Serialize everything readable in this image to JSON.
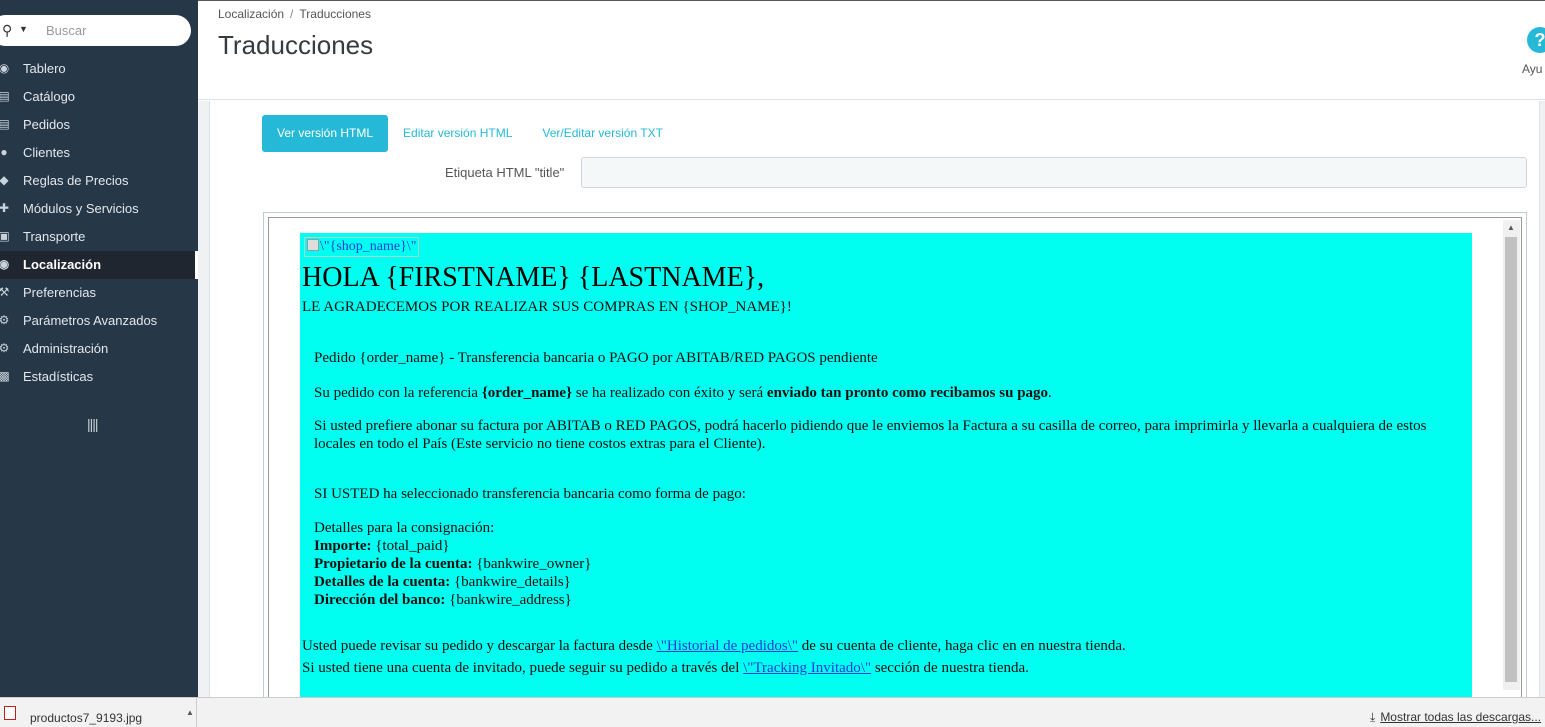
{
  "search": {
    "placeholder": "Buscar"
  },
  "sidebar": {
    "items": [
      {
        "label": "Tablero",
        "icon": "dashboard-icon"
      },
      {
        "label": "Catálogo",
        "icon": "catalog-icon"
      },
      {
        "label": "Pedidos",
        "icon": "orders-icon"
      },
      {
        "label": "Clientes",
        "icon": "customers-icon"
      },
      {
        "label": "Reglas de Precios",
        "icon": "price-rules-icon"
      },
      {
        "label": "Módulos y Servicios",
        "icon": "modules-icon"
      },
      {
        "label": "Transporte",
        "icon": "truck-icon"
      },
      {
        "label": "Localización",
        "icon": "globe-icon",
        "active": true
      },
      {
        "label": "Preferencias",
        "icon": "wrench-icon"
      },
      {
        "label": "Parámetros Avanzados",
        "icon": "cogs-icon"
      },
      {
        "label": "Administración",
        "icon": "cog-icon"
      },
      {
        "label": "Estadísticas",
        "icon": "bar-chart-icon"
      }
    ]
  },
  "header": {
    "breadcrumb": [
      "Localización",
      "Traducciones"
    ],
    "title": "Traducciones",
    "help_label": "Ayu"
  },
  "tabs": [
    {
      "label": "Ver versión HTML",
      "active": true
    },
    {
      "label": "Editar versión HTML",
      "active": false
    },
    {
      "label": "Ver/Editar versión TXT",
      "active": false
    }
  ],
  "title_field": {
    "label": "Etiqueta HTML \"title\"",
    "value": ""
  },
  "email": {
    "logo_alt": "\\\"{shop_name}\\\"",
    "greeting": "HOLA {FIRSTNAME} {LASTNAME},",
    "thanks": "LE AGRADECEMOS POR REALIZAR SUS COMPRAS EN {SHOP_NAME}!",
    "order_line": "Pedido {order_name} - Transferencia bancaria o PAGO por ABITAB/RED PAGOS pendiente",
    "ref_pre": "Su pedido con la referencia ",
    "ref_bold": "{order_name}",
    "ref_mid": " se ha realizado con éxito y será ",
    "ref_bold2": "enviado tan pronto como recibamos su pago",
    "ref_end": ".",
    "abitab": "Si usted prefiere abonar su factura por ABITAB o RED PAGOS, podrá hacerlo pidiendo que le enviemos la Factura a su casilla de correo, para imprimirla y llevarla a cualquiera de estos locales en todo el País (Este servicio no tiene costos extras para el Cliente).",
    "bankwire_intro": "SI USTED ha seleccionado transferencia bancaria como forma de pago:",
    "details_title": "Detalles para la consignación:",
    "amount_label": "Importe:",
    "amount_value": " {total_paid}",
    "owner_label": "Propietario de la cuenta:",
    "owner_value": " {bankwire_owner}",
    "details_label": "Detalles de la cuenta:",
    "details_value": " {bankwire_details}",
    "address_label": "Dirección del banco:",
    "address_value": " {bankwire_address}",
    "history_pre": "Usted puede revisar su pedido y descargar la factura desde ",
    "history_link": "\\\"Historial de pedidos\\\"",
    "history_post": " de su cuenta de cliente, haga clic en en nuestra tienda.",
    "guest_pre": "Si usted tiene una cuenta de invitado, puede seguir su pedido a través del ",
    "guest_link": "\\\"Tracking Invitado\\\"",
    "guest_post": " sección de nuestra tienda."
  },
  "downloads": {
    "file_name": "productos7_9193.jpg",
    "show_all": "Mostrar todas las descargas..."
  },
  "colors": {
    "sidebar_bg": "#263748",
    "accent": "#25b9d7",
    "email_bg": "#00fff0"
  }
}
